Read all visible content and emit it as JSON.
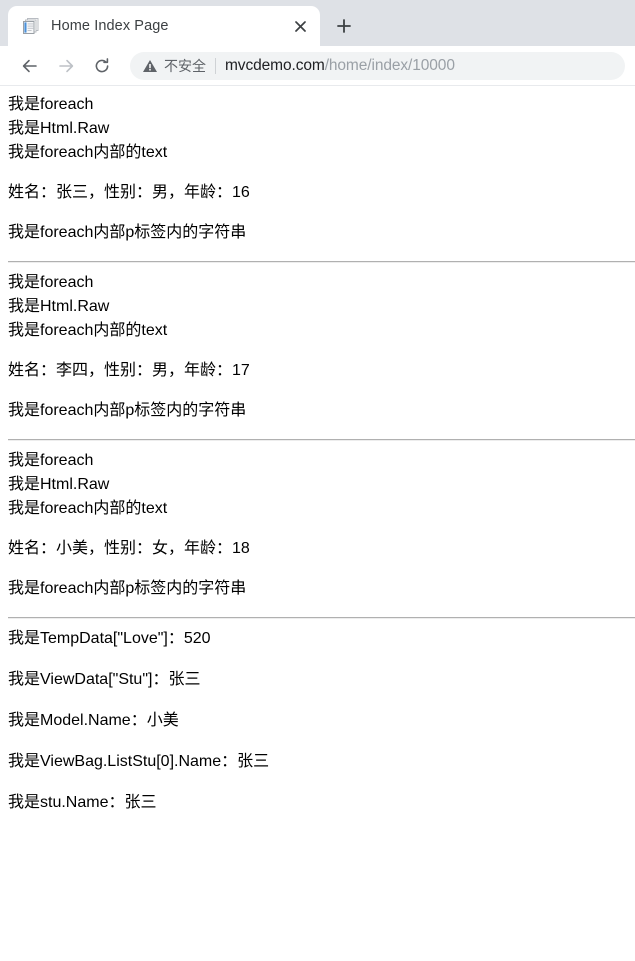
{
  "browser": {
    "tab": {
      "title": "Home Index Page",
      "favicon_name": "document-page-icon",
      "close_label": "×"
    },
    "new_tab_label": "+",
    "toolbar": {
      "back_label": "←",
      "forward_label": "→",
      "reload_label": "⟳"
    },
    "omnibox": {
      "security_icon": "warning-triangle-icon",
      "security_text": "不安全",
      "url_host": "mvcdemo.com",
      "url_path": "/home/index/10000"
    }
  },
  "page": {
    "blocks": [
      {
        "line1": "我是for each",
        "lines": [
          "我是foreach",
          "我是Html.Raw",
          "我是foreach内部的text"
        ],
        "student_line": "姓名：张三，性别：男，年龄：16",
        "p_line": "我是foreach内部p标签内的字符串"
      },
      {
        "lines": [
          "我是foreach",
          "我是Html.Raw",
          "我是foreach内部的text"
        ],
        "student_line": "姓名：李四，性别：男，年龄：17",
        "p_line": "我是foreach内部p标签内的字符串"
      },
      {
        "lines": [
          "我是foreach",
          "我是Html.Raw",
          "我是foreach内部的text"
        ],
        "student_line": "姓名：小美，性别：女，年龄：18",
        "p_line": "我是foreach内部p标签内的字符串"
      }
    ],
    "summary": [
      "我是TempData[\"Love\"]：520",
      "我是ViewData[\"Stu\"]：张三",
      "我是Model.Name：小美",
      "我是ViewBag.ListStu[0].Name：张三",
      "我是stu.Name：张三"
    ]
  }
}
